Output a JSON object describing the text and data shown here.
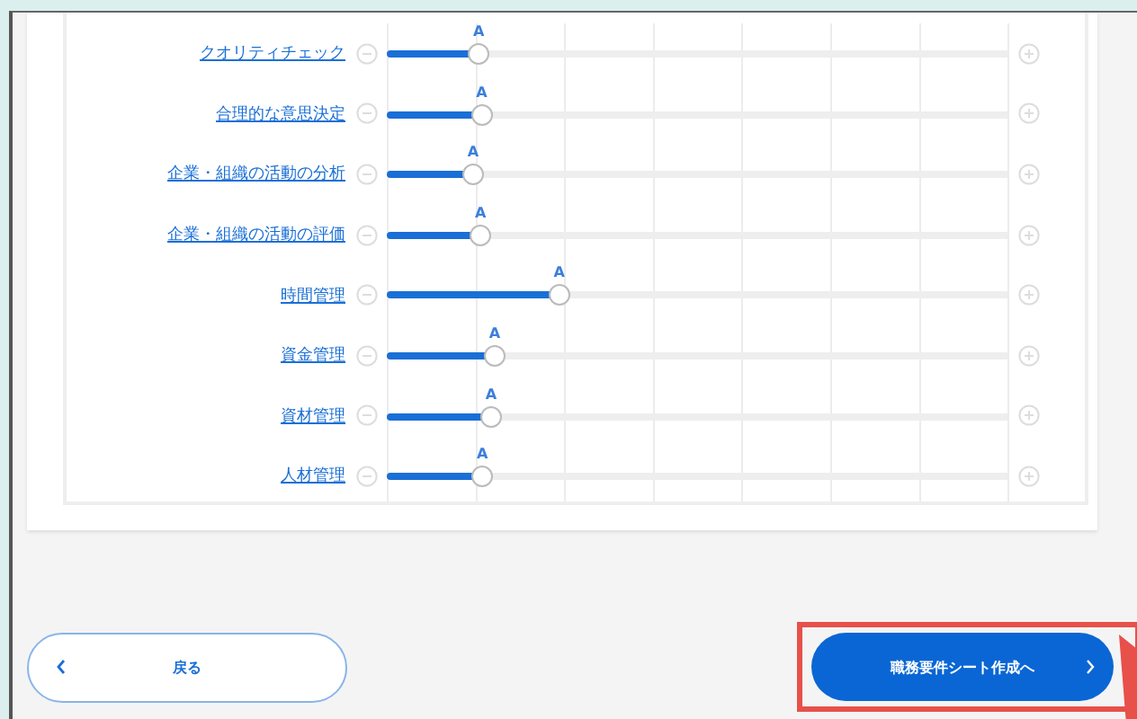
{
  "skills": [
    {
      "label": "クオリティチェック",
      "grade": "A",
      "level": 0.148
    },
    {
      "label": "合理的な意思決定",
      "grade": "A",
      "level": 0.153
    },
    {
      "label": "企業・組織の活動の分析",
      "grade": "A",
      "level": 0.139
    },
    {
      "label": "企業・組織の活動の評価",
      "grade": "A",
      "level": 0.151
    },
    {
      "label": "時間管理",
      "grade": "A",
      "level": 0.278
    },
    {
      "label": "資金管理",
      "grade": "A",
      "level": 0.174
    },
    {
      "label": "資材管理",
      "grade": "A",
      "level": 0.168
    },
    {
      "label": "人材管理",
      "grade": "A",
      "level": 0.154
    }
  ],
  "buttons": {
    "back": "戻る",
    "next": "職務要件シート作成へ"
  }
}
